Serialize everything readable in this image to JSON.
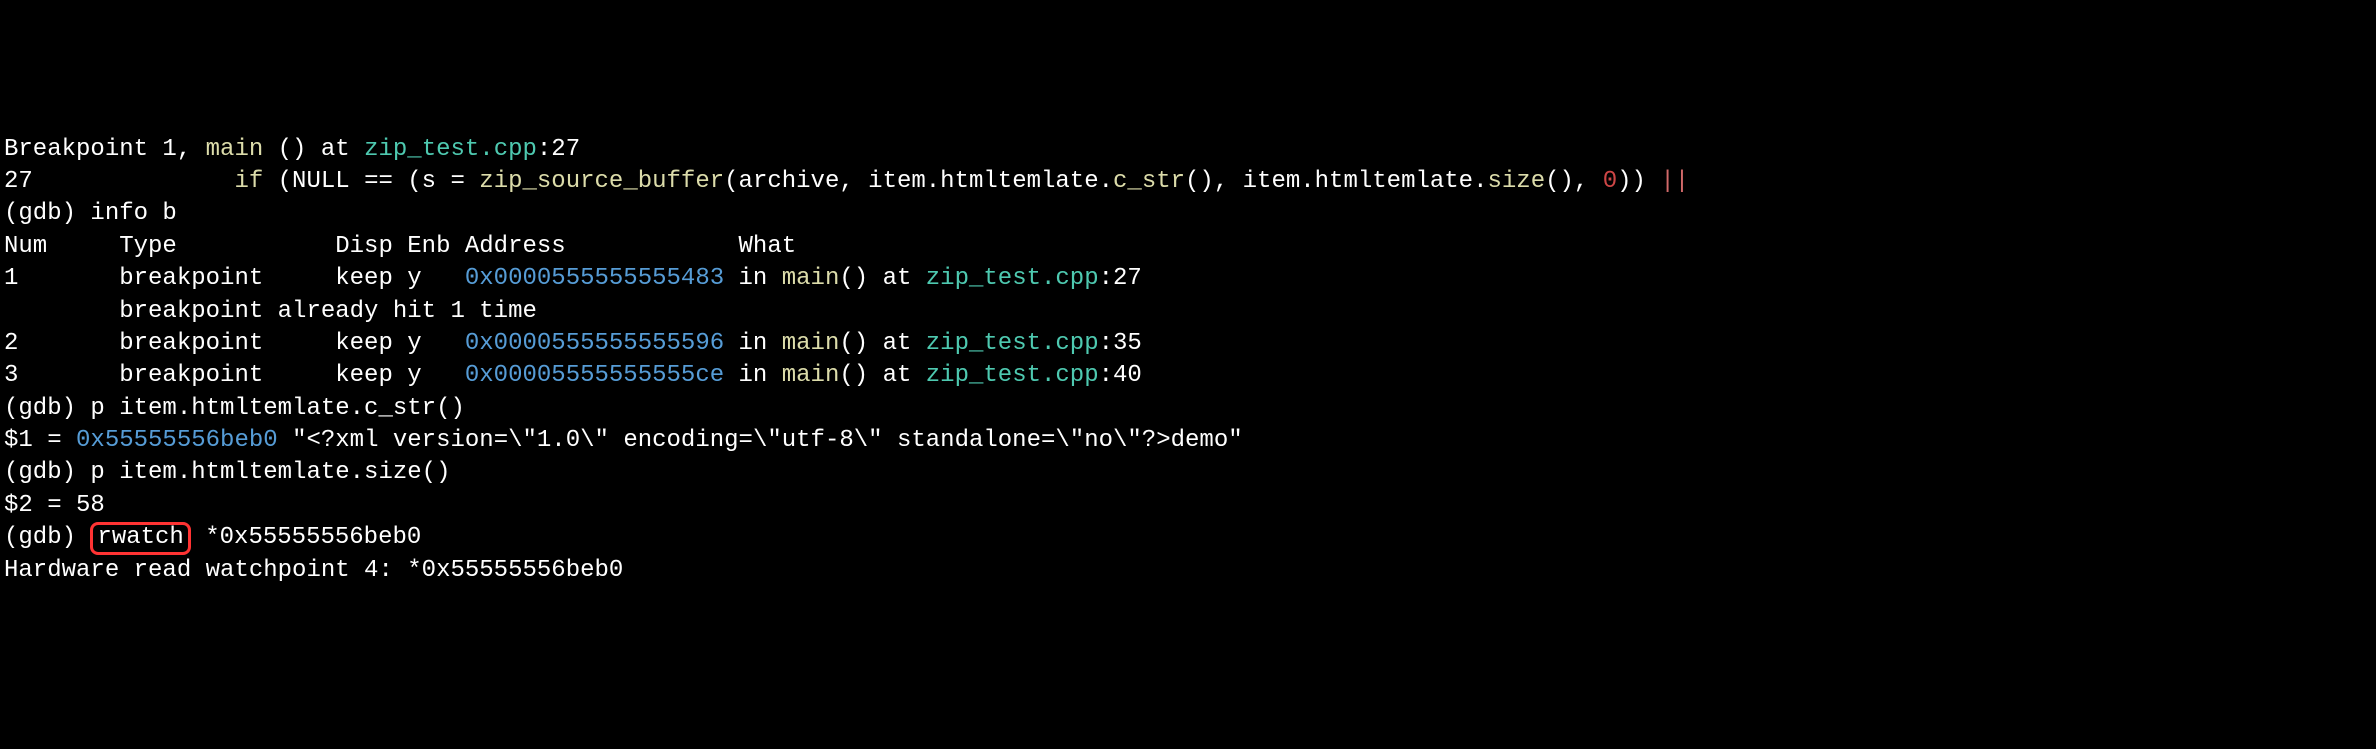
{
  "lines": {
    "l1": {
      "t1": "Breakpoint 1, ",
      "t2": "main ",
      "t3": "() at ",
      "t4": "zip_test.cpp",
      "t5": ":27"
    },
    "l2": {
      "t1": "27              ",
      "t2": "if ",
      "t3": "(NULL == (s = ",
      "t4": "zip_source_buffer",
      "t5": "(archive, item.htmltemlate.",
      "t6": "c_str",
      "t7": "(), item.htmltemlate.",
      "t8": "size",
      "t9": "(), ",
      "t10": "0",
      "t11": ")) ",
      "t12": "||"
    },
    "l3": {
      "t1": "(gdb) info b"
    },
    "l4": {
      "t1": "Num     Type           Disp Enb Address            What"
    },
    "l5": {
      "t1": "1       breakpoint     keep y   ",
      "t2": "0x0000555555555483 ",
      "t3": "in ",
      "t4": "main",
      "t5": "() at ",
      "t6": "zip_test.cpp",
      "t7": ":27"
    },
    "l6": {
      "t1": "        breakpoint already hit 1 time"
    },
    "l7": {
      "t1": "2       breakpoint     keep y   ",
      "t2": "0x0000555555555596 ",
      "t3": "in ",
      "t4": "main",
      "t5": "() at ",
      "t6": "zip_test.cpp",
      "t7": ":35"
    },
    "l8": {
      "t1": "3       breakpoint     keep y   ",
      "t2": "0x00005555555555ce ",
      "t3": "in ",
      "t4": "main",
      "t5": "() at ",
      "t6": "zip_test.cpp",
      "t7": ":40"
    },
    "l9": {
      "t1": "(gdb) p item.htmltemlate.c_str()"
    },
    "l10": {
      "t1": "$1 = ",
      "t2": "0x55555556beb0 ",
      "t3": "\"<?xml version=\\\"1.0\\\" encoding=\\\"utf-8\\\" standalone=\\\"no\\\"?>demo\""
    },
    "l11": {
      "t1": "(gdb) p item.htmltemlate.size()"
    },
    "l12": {
      "t1": "$2 = 58"
    },
    "l13": {
      "t1": "(gdb) ",
      "t2": "rwatch",
      "t3": " *0x55555556beb0"
    },
    "l14": {
      "t1": "Hardware read watchpoint 4: *0x55555556beb0"
    }
  }
}
